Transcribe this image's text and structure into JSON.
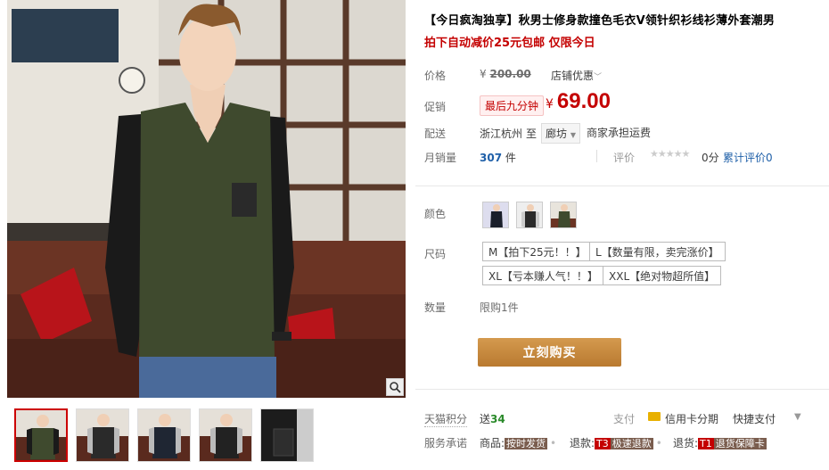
{
  "gallery": {
    "zoom_icon": "magnifier-icon",
    "thumb_count": 5
  },
  "product": {
    "title": "【今日疯淘独享】秋男士修身款撞色毛衣V领针织衫线衫薄外套潮男",
    "subtitle": "拍下自动减价25元包邮 仅限今日"
  },
  "price": {
    "label": "价格",
    "currency": "¥",
    "original": "200.00",
    "store_discount": "店铺优惠"
  },
  "promo": {
    "label": "促销",
    "badge": "最后九分钟",
    "currency": "¥",
    "price": "69.00"
  },
  "shipping": {
    "label": "配送",
    "from": "浙江杭州",
    "to_word": "至",
    "dest": "廊坊",
    "fee": "商家承担运费"
  },
  "sales": {
    "label": "月销量",
    "count": "307",
    "unit": "件",
    "rating_label": "评价",
    "stars": "★★★★★",
    "score": "0分",
    "reviews": "累计评价0"
  },
  "options": {
    "color_label": "颜色",
    "size_label": "尺码",
    "sizes": [
      "M【拍下25元！！】",
      "L【数量有限，卖完涨价】",
      "XL【亏本赚人气！！】",
      "XXL【绝对物超所值】"
    ],
    "qty_label": "数量",
    "qty_limit": "限购1件"
  },
  "buy_button": "立刻购买",
  "footer": {
    "points_label": "天猫积分",
    "points_prefix": "送",
    "points_value": "34",
    "pay_label": "支付",
    "credit": "信用卡分期",
    "quick_pay": "快捷支付",
    "service_label": "服务承诺",
    "svc1_prefix": "商品:",
    "svc1_tag": "按时发货",
    "svc2_prefix": "退款:",
    "svc2_code": "T3",
    "svc2_tag": "极速退款",
    "svc3_prefix": "退货:",
    "svc3_code": "T1",
    "svc3_tag": "退货保障卡"
  },
  "colors": {
    "accent_red": "#c40000",
    "buy_button": "#c88a3c",
    "link_blue": "#1e5fa8"
  }
}
